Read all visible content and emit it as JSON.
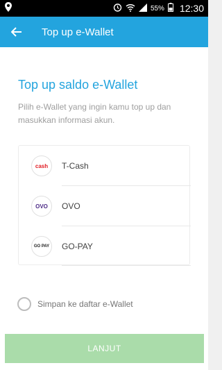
{
  "status_bar": {
    "battery": "55%",
    "time": "12:30",
    "icons": [
      "location-icon",
      "alarm-icon",
      "wifi-icon",
      "signal-icon",
      "battery-icon"
    ]
  },
  "app_bar": {
    "title": "Top up e-Wallet",
    "color": "#23a4de",
    "back_icon": "arrow-left-icon"
  },
  "main": {
    "title": "Top up saldo e-Wallet",
    "description": "Pilih e-Wallet yang ingin kamu top up dan masukkan informasi akun."
  },
  "wallets": [
    {
      "name": "T-Cash",
      "logo_text": "cash",
      "logo_color": "#e11b22"
    },
    {
      "name": "OVO",
      "logo_text": "OVO",
      "logo_color": "#4c2a86"
    },
    {
      "name": "GO-PAY",
      "logo_text": "GO PAY",
      "logo_color": "#1a1a1a"
    }
  ],
  "save_option": {
    "label": "Simpan ke daftar e-Wallet",
    "checked": false
  },
  "submit": {
    "label": "LANJUT",
    "enabled": false,
    "color": "#aadcaa"
  }
}
